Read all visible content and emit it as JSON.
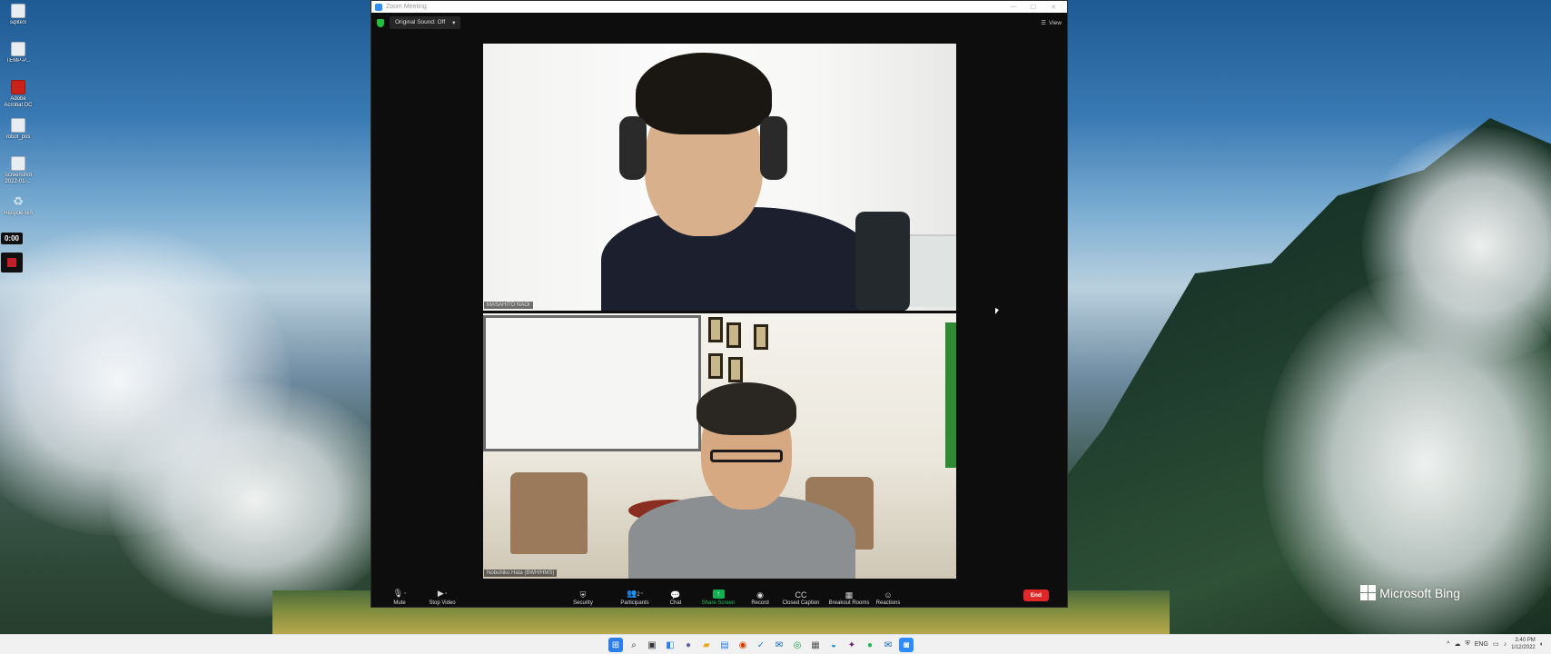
{
  "desktop": {
    "icons": [
      {
        "label": "sqliteS",
        "icon": "file-icon"
      },
      {
        "label": "TEMP-P...",
        "icon": "document-icon"
      },
      {
        "label": "Adobe Acrobat DC",
        "icon": "pdf-icon"
      },
      {
        "label": "robot_pos",
        "icon": "file-icon"
      },
      {
        "label": "Screenshot 2022-01-...",
        "icon": "image-icon"
      },
      {
        "label": "Recycle Bin",
        "icon": "recycle-bin-icon"
      }
    ],
    "timer": "0:00",
    "bing_label": "Microsoft Bing"
  },
  "window": {
    "title": "Zoom Meeting",
    "original_sound": "Original Sound: Off",
    "view_label": "View"
  },
  "participants": [
    {
      "name": "MASAHITO NAOI"
    },
    {
      "name": "Nobuhiko Hata (BWH/HMS)"
    }
  ],
  "toolbar": {
    "mute": "Mute",
    "stop_video": "Stop Video",
    "security": "Security",
    "participants": "Participants",
    "participants_count": "2",
    "chat": "Chat",
    "share_screen": "Share Screen",
    "record": "Record",
    "closed_caption": "Closed Caption",
    "breakout_rooms": "Breakout Rooms",
    "reactions": "Reactions",
    "end": "End"
  },
  "taskbar": {
    "language": "ENG",
    "time": "3:40 PM",
    "date": "1/12/2022"
  },
  "colors": {
    "share_green": "#12b050",
    "end_red": "#e02828",
    "zoom_blue": "#2d8cff"
  }
}
